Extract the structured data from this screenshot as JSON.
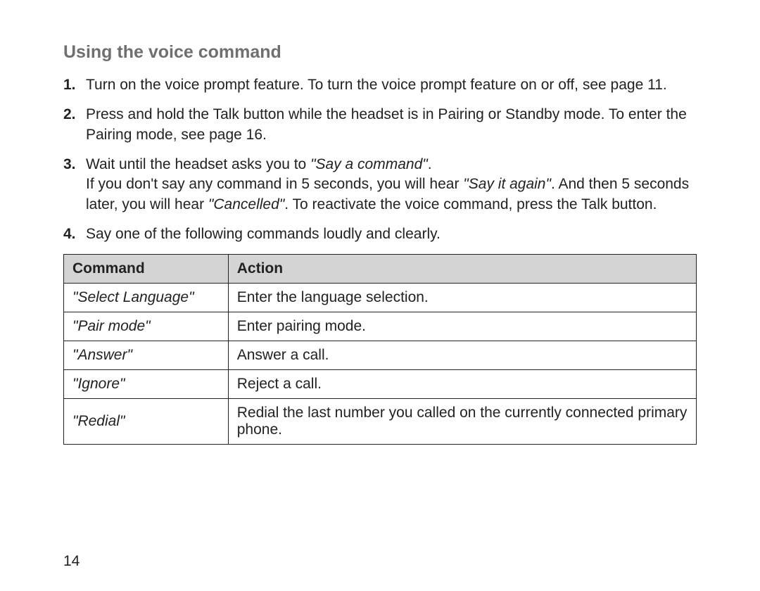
{
  "heading": "Using the voice command",
  "steps": [
    {
      "marker": "1.",
      "marker_bold": true,
      "html": "Turn on the voice prompt feature. To turn the voice prompt feature on or off, see page 11."
    },
    {
      "marker": "2.",
      "marker_bold": true,
      "html": "Press and hold the Talk button while the headset is in Pairing or Standby mode. To enter the Pairing mode, see page 16."
    },
    {
      "marker": "3.",
      "marker_bold": true,
      "html": "Wait until the headset asks you to <span class=\"italic\">\"Say a command\"</span>.<br>If you don't say any command in 5 seconds, you will hear <span class=\"italic\">\"Say it again\"</span>. And then 5 seconds later, you will hear <span class=\"italic\">\"Cancelled\"</span>. To reactivate the voice command, press the Talk button."
    },
    {
      "marker": "4.",
      "marker_bold": true,
      "html": "Say one of the following commands loudly and clearly."
    }
  ],
  "table": {
    "headers": {
      "command": "Command",
      "action": "Action"
    },
    "rows": [
      {
        "command": "\"Select Language\"",
        "action": "Enter the language selection."
      },
      {
        "command": "\"Pair mode\"",
        "action": "Enter pairing mode."
      },
      {
        "command": "\"Answer\"",
        "action": "Answer a call."
      },
      {
        "command": "\"Ignore\"",
        "action": "Reject a call."
      },
      {
        "command": "\"Redial\"",
        "action": "Redial the last number you called on the currently connected primary phone."
      }
    ]
  },
  "page_number": "14"
}
